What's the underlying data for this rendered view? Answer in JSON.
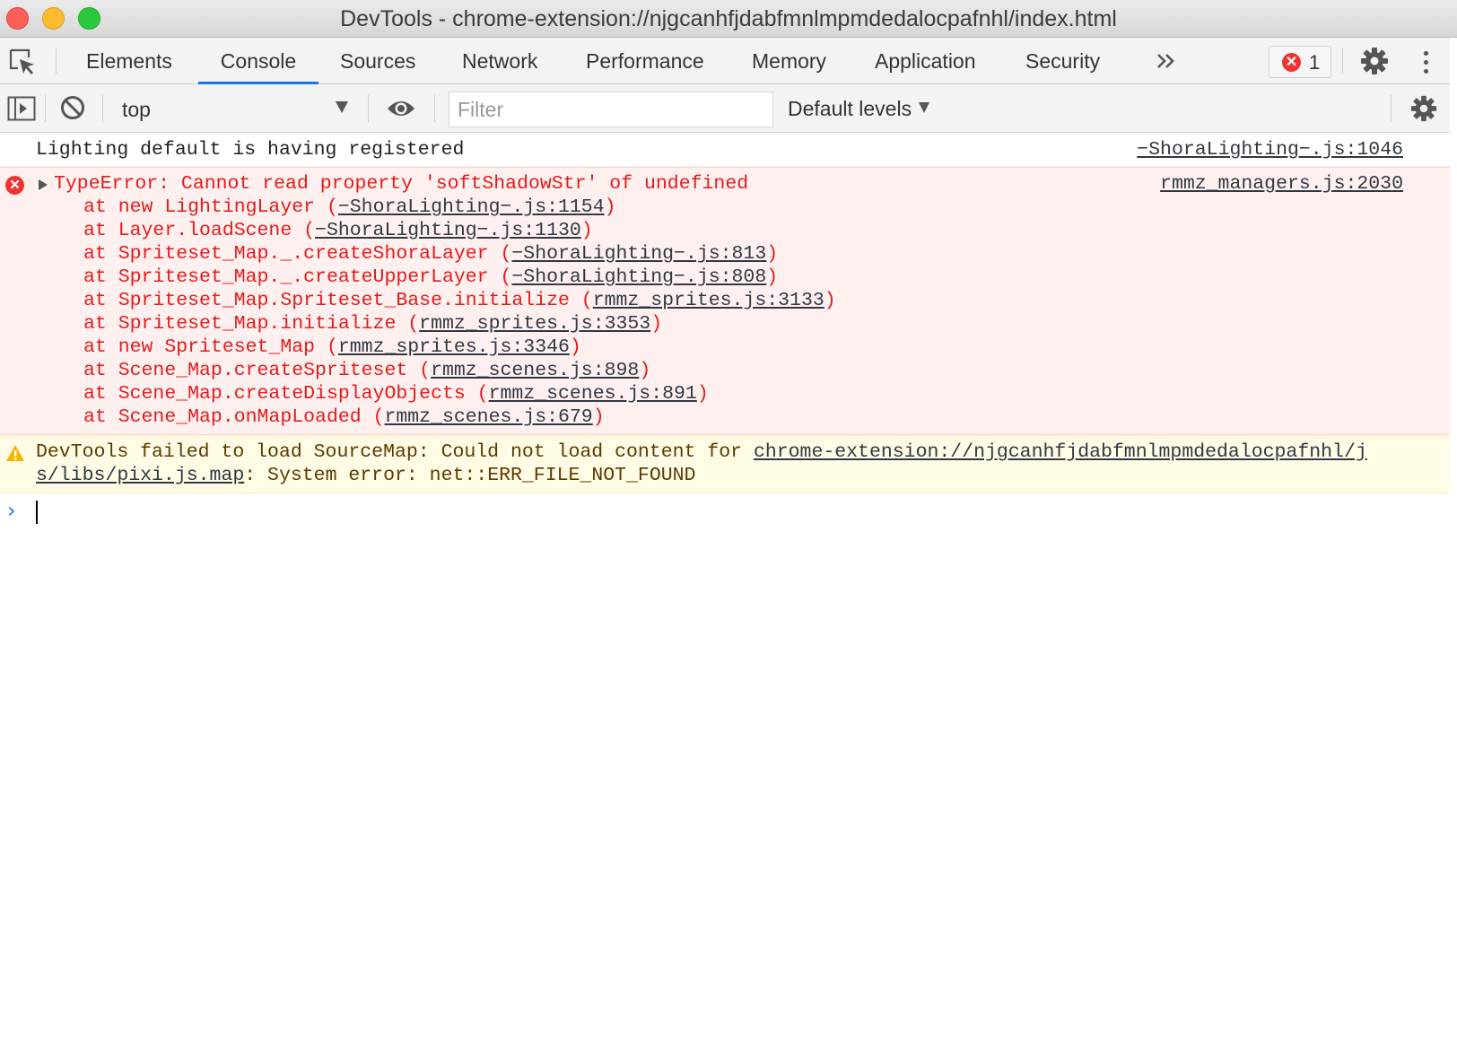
{
  "window": {
    "title": "DevTools - chrome-extension://njgcanhfjdabfmnlmpmdedalocpafnhl/index.html"
  },
  "tabs": [
    {
      "label": "Elements"
    },
    {
      "label": "Console",
      "active": true
    },
    {
      "label": "Sources"
    },
    {
      "label": "Network"
    },
    {
      "label": "Performance"
    },
    {
      "label": "Memory"
    },
    {
      "label": "Application"
    },
    {
      "label": "Security"
    }
  ],
  "error_badge": {
    "count": "1"
  },
  "toolbar": {
    "context": "top",
    "filter_placeholder": "Filter",
    "levels": "Default levels"
  },
  "messages": {
    "log": {
      "text": "Lighting default is having registered",
      "source": "−ShoraLighting−.js:1046"
    },
    "error": {
      "head": "TypeError: Cannot read property 'softShadowStr' of undefined",
      "source": "rmmz_managers.js:2030",
      "stack": [
        {
          "prefix": "at new LightingLayer (",
          "link": "−ShoraLighting−.js:1154",
          "suffix": ")"
        },
        {
          "prefix": "at Layer.loadScene (",
          "link": "−ShoraLighting−.js:1130",
          "suffix": ")"
        },
        {
          "prefix": "at Spriteset_Map._.createShoraLayer (",
          "link": "−ShoraLighting−.js:813",
          "suffix": ")"
        },
        {
          "prefix": "at Spriteset_Map._.createUpperLayer (",
          "link": "−ShoraLighting−.js:808",
          "suffix": ")"
        },
        {
          "prefix": "at Spriteset_Map.Spriteset_Base.initialize (",
          "link": "rmmz_sprites.js:3133",
          "suffix": ")"
        },
        {
          "prefix": "at Spriteset_Map.initialize (",
          "link": "rmmz_sprites.js:3353",
          "suffix": ")"
        },
        {
          "prefix": "at new Spriteset_Map (",
          "link": "rmmz_sprites.js:3346",
          "suffix": ")"
        },
        {
          "prefix": "at Scene_Map.createSpriteset (",
          "link": "rmmz_scenes.js:898",
          "suffix": ")"
        },
        {
          "prefix": "at Scene_Map.createDisplayObjects (",
          "link": "rmmz_scenes.js:891",
          "suffix": ")"
        },
        {
          "prefix": "at Scene_Map.onMapLoaded (",
          "link": "rmmz_scenes.js:679",
          "suffix": ")"
        }
      ]
    },
    "warning": {
      "prefix": "DevTools failed to load SourceMap: Could not load content for ",
      "link_line1": "chrome-extension://njgcanhfjdabfmnlmpmdedalocpafnhl/j",
      "link_line2": "s/libs/pixi.js.map",
      "suffix": ": System error: net::ERR_FILE_NOT_FOUND"
    }
  },
  "prompt": {
    "chevron": "›"
  },
  "colors": {
    "accent": "#1a73e8",
    "error_text": "#e41b1b",
    "error_bg": "#fff0f0",
    "warning_bg": "#fffbe5"
  },
  "icons": [
    "inspect-element-icon",
    "drawer-toggle-icon",
    "clear-console-icon",
    "eye-icon",
    "chevron-double-right-icon",
    "gear-icon",
    "kebab-menu-icon",
    "error-icon",
    "warning-icon"
  ]
}
